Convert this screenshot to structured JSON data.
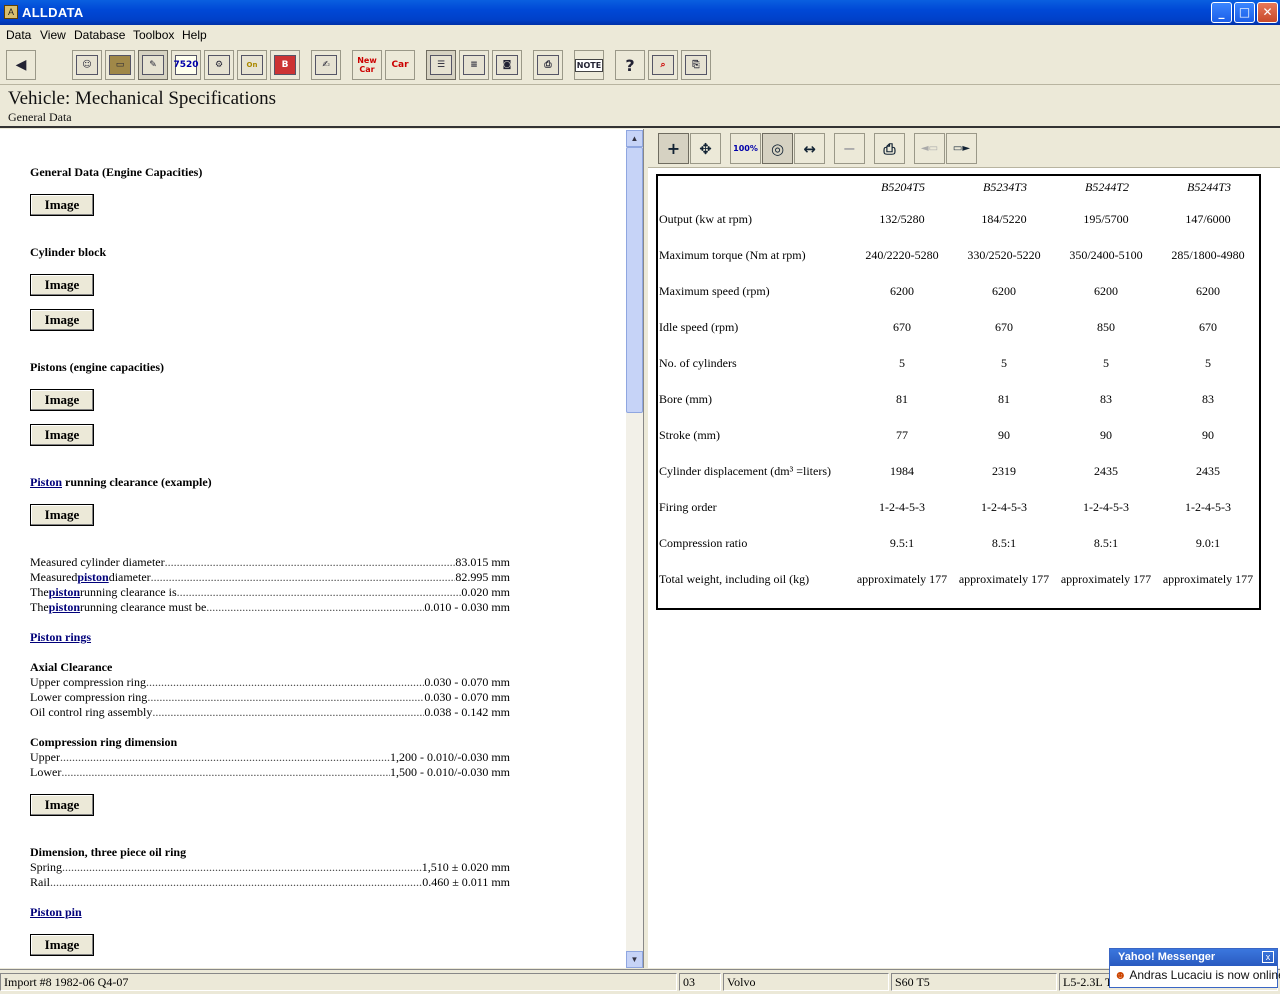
{
  "window": {
    "title": "ALLDATA",
    "min": "_",
    "max": "□",
    "close": "✕"
  },
  "menu": [
    "Data",
    "View",
    "Database",
    "Toolbox",
    "Help"
  ],
  "toolbar": {
    "back": "◀",
    "new_car": "New Car",
    "prev_car": "Car",
    "note": "NOTE",
    "help": "?"
  },
  "header": {
    "title": "Vehicle:  Mechanical Specifications",
    "subtitle": "General Data"
  },
  "left": {
    "s1": "General Data (Engine Capacities)",
    "s2": "Cylinder block",
    "s3": "Pistons (engine capacities)",
    "s4_link": "Piston",
    "s4_rest": " running clearance (example)",
    "image_label": "Image",
    "m1": {
      "label": "Measured cylinder diameter",
      "value": "83.015 mm"
    },
    "m2": {
      "pre": "Measured ",
      "link": "piston",
      "post": " diameter",
      "value": "82.995 mm"
    },
    "m3": {
      "pre": "The ",
      "link": "piston",
      "post": " running clearance is",
      "value": "0.020 mm"
    },
    "m4": {
      "pre": "The ",
      "link": "piston",
      "post": " running clearance must be",
      "value": "0.010 - 0.030 mm"
    },
    "piston_rings": "Piston rings",
    "axial": "Axial Clearance",
    "a1": {
      "label": "Upper compression ring",
      "value": "0.030 - 0.070 mm"
    },
    "a2": {
      "label": "Lower compression ring",
      "value": "0.030 - 0.070 mm"
    },
    "a3": {
      "label": "Oil control ring assembly",
      "value": "0.038 - 0.142 mm"
    },
    "crd": "Compression ring dimension",
    "c1": {
      "label": "Upper",
      "value": "1,200 - 0.010/-0.030 mm"
    },
    "c2": {
      "label": "Lower",
      "value": "1,500 - 0.010/-0.030 mm"
    },
    "d3": "Dimension, three piece oil ring",
    "d1": {
      "label": "Spring",
      "value": "1,510 ± 0.020 mm"
    },
    "d2": {
      "label": "Rail",
      "value": "0.460 ± 0.011 mm"
    },
    "piston_pin": "Piston pin"
  },
  "right": {
    "tools": {
      "zoom": "+",
      "move": "✥",
      "zoom100": "100%",
      "zoomfit": "◎",
      "zoomwidth": "↔",
      "zoomout": "−",
      "print": "⎙"
    },
    "columns": [
      "B5204T5",
      "B5234T3",
      "B5244T2",
      "B5244T3"
    ],
    "rows": [
      {
        "label": "Output (kw at rpm)",
        "values": [
          "132/5280",
          "184/5220",
          "195/5700",
          "147/6000"
        ]
      },
      {
        "label": "Maximum torque (Nm at rpm)",
        "values": [
          "240/2220-5280",
          "330/2520-5220",
          "350/2400-5100",
          "285/1800-4980"
        ]
      },
      {
        "label": "Maximum speed (rpm)",
        "values": [
          "6200",
          "6200",
          "6200",
          "6200"
        ]
      },
      {
        "label": "Idle speed (rpm)",
        "values": [
          "670",
          "670",
          "850",
          "670"
        ]
      },
      {
        "label": "No. of cylinders",
        "values": [
          "5",
          "5",
          "5",
          "5"
        ]
      },
      {
        "label": "Bore (mm)",
        "values": [
          "81",
          "81",
          "83",
          "83"
        ]
      },
      {
        "label": "Stroke (mm)",
        "values": [
          "77",
          "90",
          "90",
          "90"
        ]
      },
      {
        "label": "Cylinder displacement (dm³ =liters)",
        "values": [
          "1984",
          "2319",
          "2435",
          "2435"
        ]
      },
      {
        "label": "Firing order",
        "values": [
          "1-2-4-5-3",
          "1-2-4-5-3",
          "1-2-4-5-3",
          "1-2-4-5-3"
        ]
      },
      {
        "label": "Compression ratio",
        "values": [
          "9.5:1",
          "8.5:1",
          "8.5:1",
          "9.0:1"
        ]
      },
      {
        "label": "Total weight, including oil (kg)",
        "values": [
          "approximately 177",
          "approximately 177",
          "approximately 177",
          "approximately 177"
        ]
      }
    ]
  },
  "status": {
    "import": "Import #8 1982-06 Q4-07",
    "code": "03",
    "make": "Volvo",
    "model": "S60 T5",
    "engine": "L5-2.3L T"
  },
  "yahoo": {
    "title": "Yahoo! Messenger",
    "message": "Andras Lucaciu is now online",
    "close": "x"
  }
}
